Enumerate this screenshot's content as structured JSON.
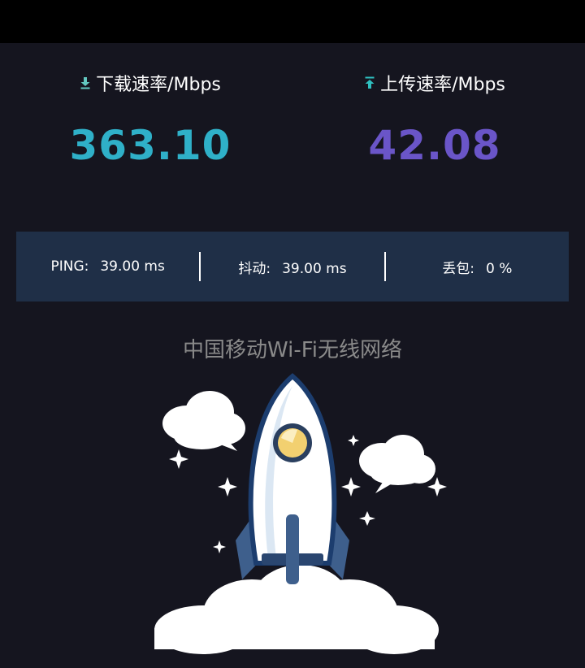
{
  "download": {
    "label": "下载速率/Mbps",
    "value": "363.10",
    "icon": "download-arrow-icon",
    "color": "#2fb0c8"
  },
  "upload": {
    "label": "上传速率/Mbps",
    "value": "42.08",
    "icon": "upload-arrow-icon",
    "color": "#6a55c8"
  },
  "stats": {
    "ping_label": "PING:",
    "ping_value": "39.00 ms",
    "jitter_label": "抖动:",
    "jitter_value": "39.00 ms",
    "loss_label": "丢包:",
    "loss_value": "0 %"
  },
  "network": {
    "name": "中国移动Wi-Fi无线网络"
  },
  "illustration": {
    "icon": "rocket-launch-illustration"
  }
}
